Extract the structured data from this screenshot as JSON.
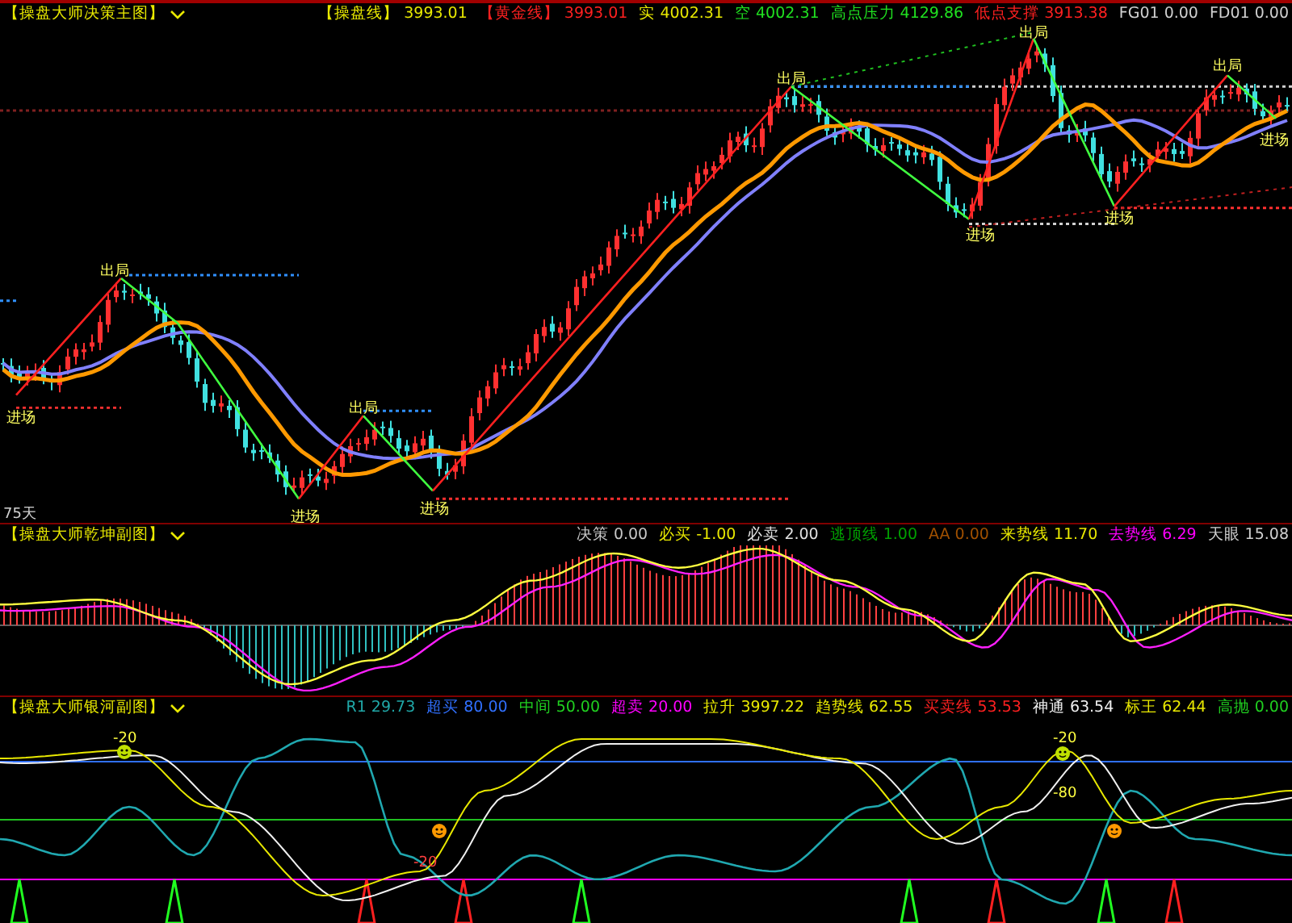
{
  "main_panel": {
    "title": "【操盘大师决策主图】",
    "readings": [
      {
        "label": "【操盘线】",
        "value": "3993.01",
        "color": "#e8e800"
      },
      {
        "label": "【黄金线】",
        "value": "3993.01",
        "color": "#ff2020"
      },
      {
        "label": "实",
        "value": "4002.31",
        "color": "#e8e800"
      },
      {
        "label": "空",
        "value": "4002.31",
        "color": "#20e020"
      },
      {
        "label": "高点压力",
        "value": "4129.86",
        "color": "#20e020"
      },
      {
        "label": "低点支撑",
        "value": "3913.38",
        "color": "#ff2020"
      },
      {
        "label": "FG01",
        "value": "0.00",
        "color": "#d0d0d0"
      },
      {
        "label": "FD01",
        "value": "0.00",
        "color": "#d0d0d0"
      }
    ],
    "chart_labels": [
      "出局",
      "出局",
      "出局",
      "出局",
      "出局",
      "进场",
      "进场",
      "进场",
      "进场",
      "进场",
      "进场",
      "75天"
    ]
  },
  "sub_panel_1": {
    "title": "【操盘大师乾坤副图】",
    "readings": [
      {
        "label": "决策",
        "value": "0.00",
        "color": "#c8c8c8"
      },
      {
        "label": "必买",
        "value": "-1.00",
        "color": "#e8e800"
      },
      {
        "label": "必卖",
        "value": "2.00",
        "color": "#e0e0e0"
      },
      {
        "label": "逃顶线",
        "value": "1.00",
        "color": "#00a000"
      },
      {
        "label": "AA",
        "value": "0.00",
        "color": "#a05000"
      },
      {
        "label": "来势线",
        "value": "11.70",
        "color": "#e8e800"
      },
      {
        "label": "去势线",
        "value": "6.29",
        "color": "#ff00ff"
      },
      {
        "label": "天眼",
        "value": "15.08",
        "color": "#d0d0d0"
      }
    ]
  },
  "sub_panel_2": {
    "title": "【操盘大师银河副图】",
    "readings": [
      {
        "label": "R1",
        "value": "29.73",
        "color": "#20a8a8"
      },
      {
        "label": "超买",
        "value": "80.00",
        "color": "#3070ff"
      },
      {
        "label": "中间",
        "value": "50.00",
        "color": "#20d020"
      },
      {
        "label": "超卖",
        "value": "20.00",
        "color": "#ff00ff"
      },
      {
        "label": "拉升",
        "value": "3997.22",
        "color": "#e8e800"
      },
      {
        "label": "趋势线",
        "value": "62.55",
        "color": "#e8e800"
      },
      {
        "label": "买卖线",
        "value": "53.53",
        "color": "#ff2020"
      },
      {
        "label": "神通",
        "value": "63.54",
        "color": "#f0f0f0"
      },
      {
        "label": "标王",
        "value": "62.44",
        "color": "#e8e800"
      },
      {
        "label": "高抛",
        "value": "0.00",
        "color": "#20d020"
      }
    ],
    "chart_labels": [
      "-20",
      "-20",
      "-20",
      "-80"
    ]
  }
}
